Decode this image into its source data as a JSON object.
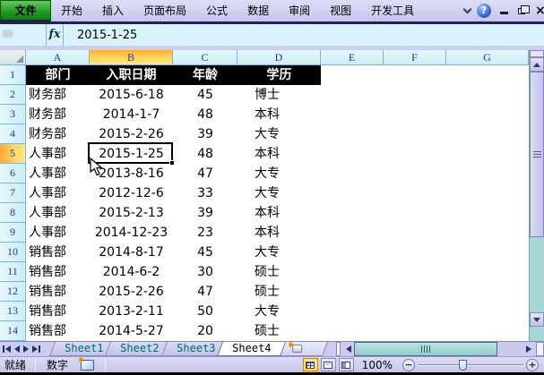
{
  "menubar": {
    "file_label": "文件",
    "items": [
      "开始",
      "插入",
      "页面布局",
      "公式",
      "数据",
      "审阅",
      "视图",
      "开发工具"
    ],
    "icons": {
      "chevron_down": "chevron-down",
      "help_glyph": "?",
      "close_glyph": "×"
    }
  },
  "formula_bar": {
    "fx_label": "fx",
    "value": "2015-1-25"
  },
  "grid": {
    "column_headers": [
      "A",
      "B",
      "C",
      "D",
      "E",
      "F",
      "G"
    ],
    "selected_column": "B",
    "selected_row": "5",
    "selected_cell": {
      "column": "B",
      "row": "5",
      "value": "2015-1-25"
    },
    "rows": [
      {
        "n": "1",
        "type": "header",
        "values": [
          "部门",
          "入职日期",
          "年龄",
          "学历"
        ]
      },
      {
        "n": "2",
        "values": [
          "财务部",
          "2015-6-18",
          "45",
          "博士"
        ]
      },
      {
        "n": "3",
        "values": [
          "财务部",
          "2014-1-7",
          "48",
          "本科"
        ]
      },
      {
        "n": "4",
        "values": [
          "财务部",
          "2015-2-26",
          "39",
          "大专"
        ]
      },
      {
        "n": "5",
        "selected": true,
        "values": [
          "人事部",
          "2015-1-25",
          "48",
          "本科"
        ]
      },
      {
        "n": "6",
        "values": [
          "人事部",
          "2013-8-16",
          "47",
          "大专"
        ]
      },
      {
        "n": "7",
        "values": [
          "人事部",
          "2012-12-6",
          "33",
          "大专"
        ]
      },
      {
        "n": "8",
        "values": [
          "人事部",
          "2015-2-13",
          "39",
          "本科"
        ]
      },
      {
        "n": "9",
        "values": [
          "人事部",
          "2014-12-23",
          "23",
          "本科"
        ]
      },
      {
        "n": "10",
        "values": [
          "销售部",
          "2014-8-17",
          "45",
          "大专"
        ]
      },
      {
        "n": "11",
        "values": [
          "销售部",
          "2014-6-2",
          "30",
          "硕士"
        ]
      },
      {
        "n": "12",
        "values": [
          "销售部",
          "2015-2-26",
          "47",
          "硕士"
        ]
      },
      {
        "n": "13",
        "values": [
          "销售部",
          "2013-2-11",
          "50",
          "大专"
        ]
      },
      {
        "n": "14",
        "values": [
          "销售部",
          "2014-5-27",
          "20",
          "硕士"
        ]
      }
    ]
  },
  "sheet_tabs": {
    "tabs": [
      {
        "label": "Sheet1",
        "active": false
      },
      {
        "label": "Sheet2",
        "active": false
      },
      {
        "label": "Sheet3",
        "active": false
      },
      {
        "label": "Sheet4",
        "active": true
      }
    ],
    "active": "Sheet4"
  },
  "status_bar": {
    "ready_label": "就绪",
    "mode_label": "数字",
    "zoom_level": "100%",
    "zoom_out_glyph": "−",
    "zoom_in_glyph": "+"
  },
  "colors": {
    "menubar_bg": "#ccccf0",
    "file_button_green": "#1f9a1f",
    "formula_bar_bg": "#d9f3fa",
    "header_cyan": "#cdeef4",
    "selected_header_orange": "#ffb038",
    "table_header_bg": "#000000",
    "table_header_text": "#ffffff",
    "tab_text_teal": "#006b6b",
    "scrollbar_teal": "#a5d8d4"
  }
}
